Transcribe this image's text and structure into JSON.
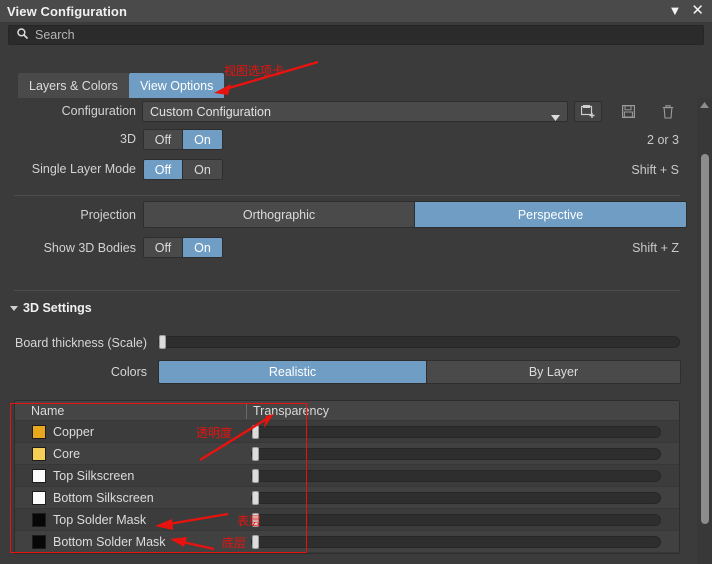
{
  "window": {
    "title": "View Configuration",
    "minimize_icon": "chevron-down-icon",
    "minimize_glyph": "▼",
    "close_icon": "close-icon",
    "close_glyph": "✕"
  },
  "search": {
    "placeholder": "Search",
    "value": "",
    "icon": "search-icon"
  },
  "tabs": [
    {
      "label": "Layers & Colors",
      "active": false
    },
    {
      "label": "View Options",
      "active": true
    }
  ],
  "configuration": {
    "label": "Configuration",
    "value": "Custom Configuration",
    "dropdown_icon": "chevron-down-icon",
    "buttons": [
      {
        "name": "save-as-icon",
        "title": "Save As"
      },
      {
        "name": "save-icon",
        "title": "Save"
      },
      {
        "name": "trash-icon",
        "title": "Delete"
      }
    ]
  },
  "view_options": {
    "rows": [
      {
        "label": "3D",
        "options": [
          "Off",
          "On"
        ],
        "selected": "On",
        "hint": "2 or 3"
      },
      {
        "label": "Single Layer Mode",
        "options": [
          "Off",
          "On"
        ],
        "selected": "Off",
        "hint": "Shift + S"
      }
    ],
    "projection": {
      "label": "Projection",
      "options": [
        "Orthographic",
        "Perspective"
      ],
      "selected": "Perspective"
    },
    "show_3d_bodies": {
      "label": "Show 3D Bodies",
      "options": [
        "Off",
        "On"
      ],
      "selected": "On",
      "hint": "Shift + Z"
    }
  },
  "settings_3d": {
    "header": "3D Settings",
    "collapse_icon": "triangle-down-icon",
    "board_thickness": {
      "label": "Board thickness (Scale)",
      "value": 0
    },
    "colors": {
      "label": "Colors",
      "options": [
        "Realistic",
        "By Layer"
      ],
      "selected": "Realistic"
    }
  },
  "layer_table": {
    "columns": [
      "Name",
      "Transparency"
    ],
    "rows": [
      {
        "name": "Copper",
        "color": "#e8a81c",
        "transparency": 0
      },
      {
        "name": "Core",
        "color": "#f5cf55",
        "transparency": 0
      },
      {
        "name": "Top Silkscreen",
        "color": "#fbfbfb",
        "transparency": 0
      },
      {
        "name": "Bottom Silkscreen",
        "color": "#fbfbfb",
        "transparency": 0
      },
      {
        "name": "Top Solder Mask",
        "color": "#070707",
        "transparency": 0
      },
      {
        "name": "Bottom Solder Mask",
        "color": "#070707",
        "transparency": 0
      }
    ]
  },
  "scrollbar": {
    "up_icon": "triangle-up-icon"
  },
  "annotations": [
    {
      "id": "tab-note",
      "text": "视图选项卡"
    },
    {
      "id": "transparency-note",
      "text": "透明度"
    },
    {
      "id": "top-layer-note",
      "text": "表层"
    },
    {
      "id": "bottom-layer-note",
      "text": "底层"
    }
  ],
  "colors": {
    "accent": "#6f9dc4",
    "annotation": "#e8130f",
    "panel_bg": "#3b3b3b",
    "titlebar_bg": "#4a4a4a"
  }
}
